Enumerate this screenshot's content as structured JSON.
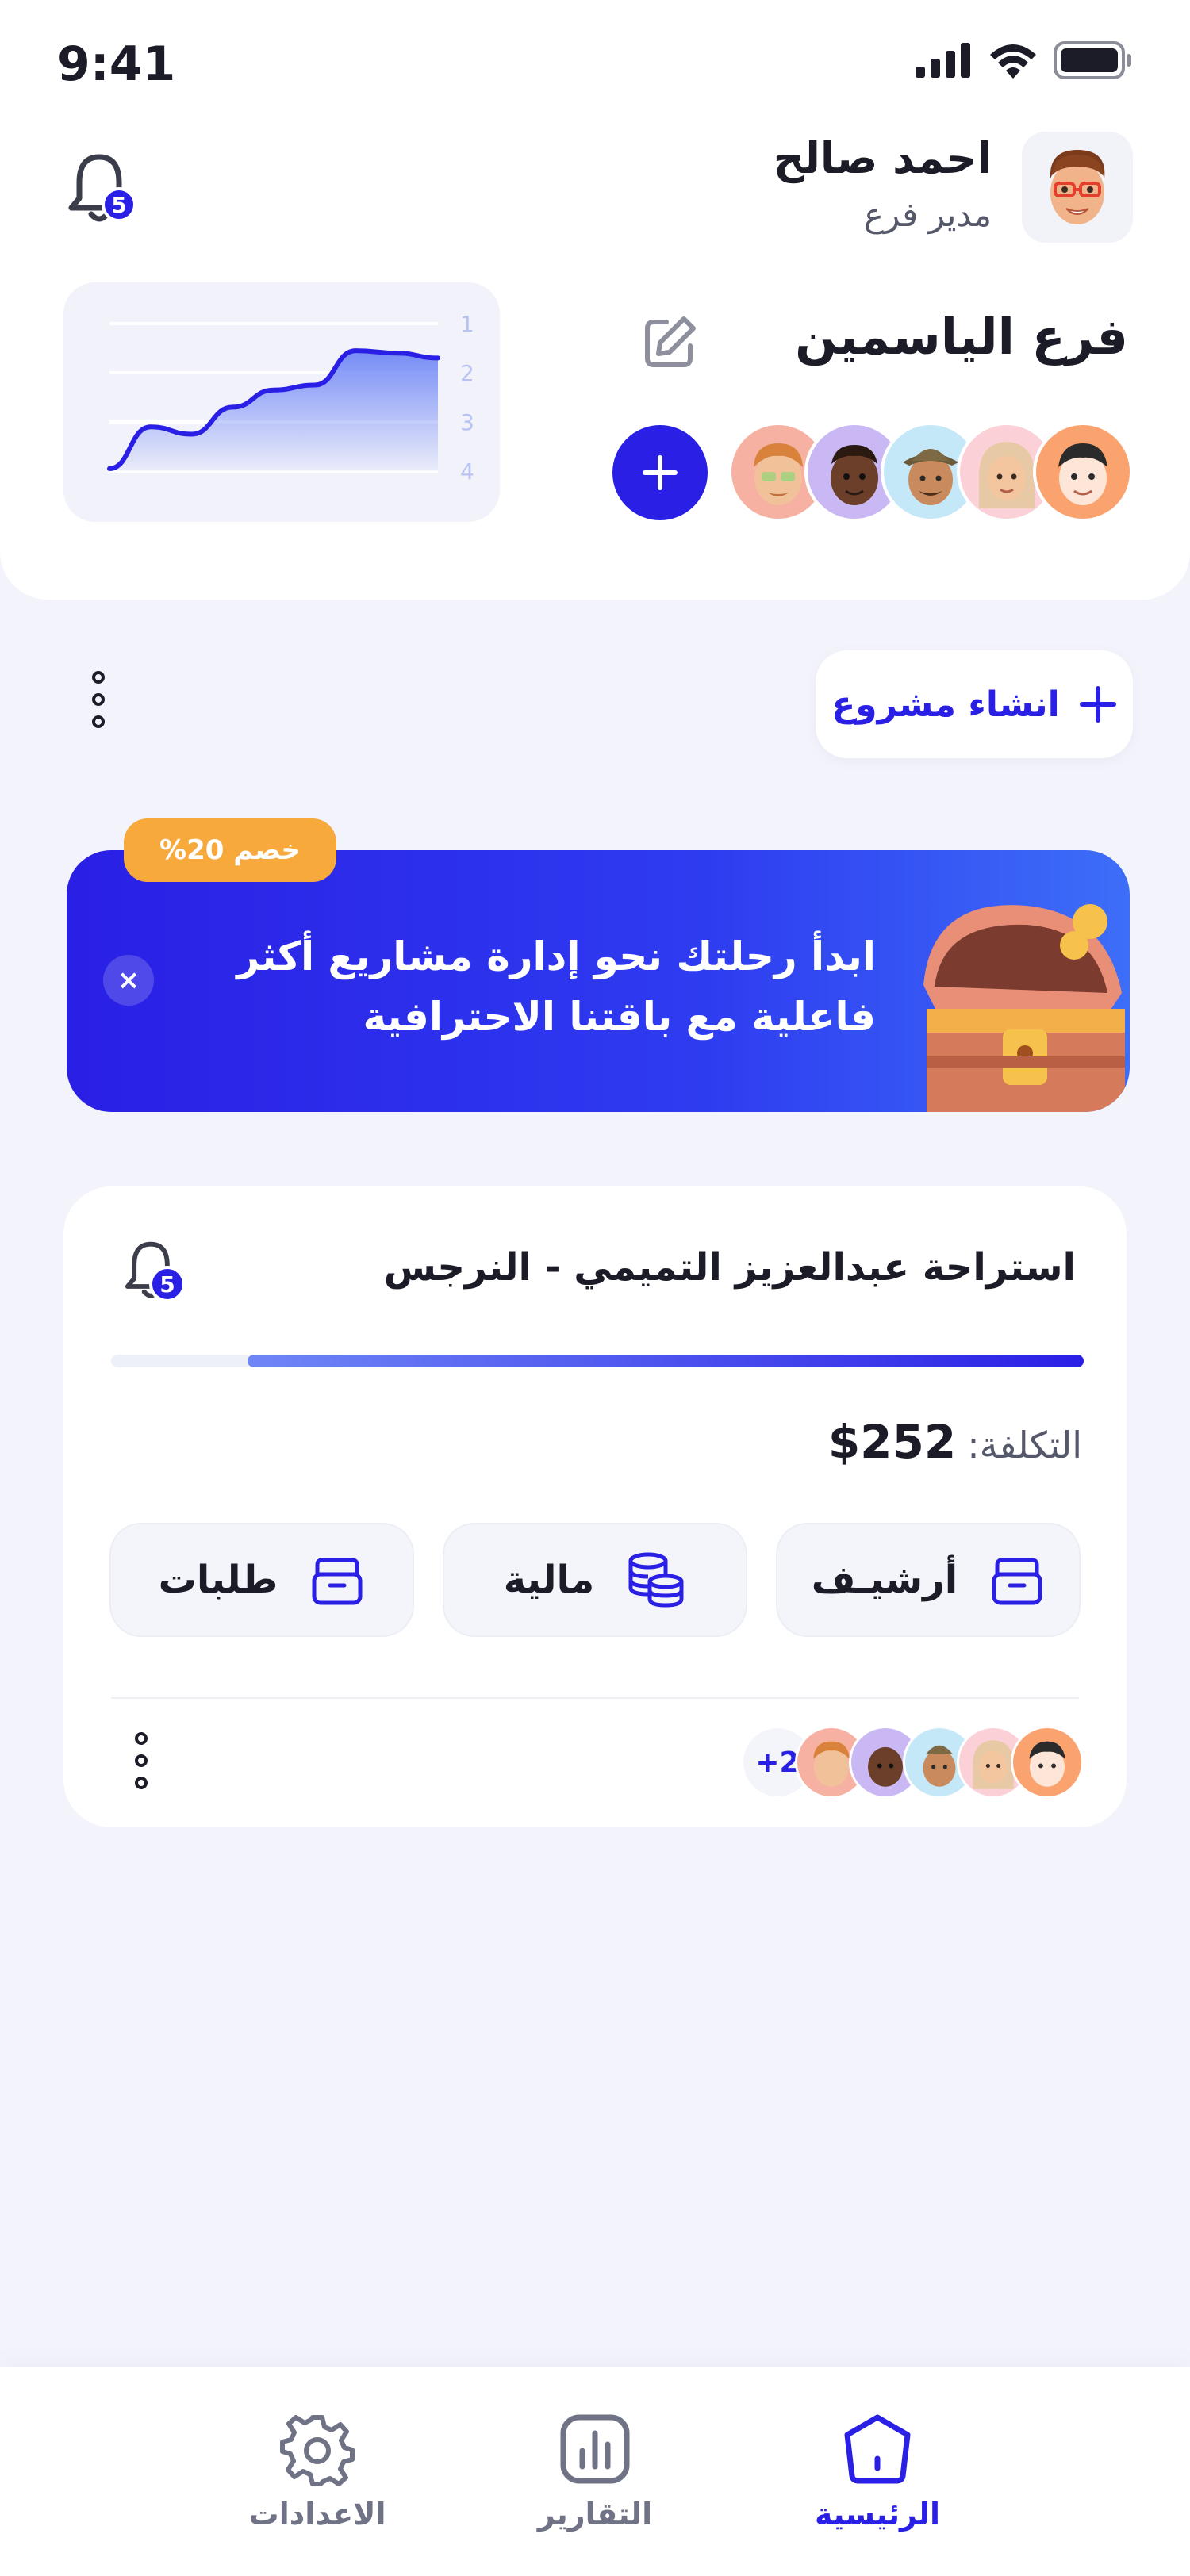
{
  "status_bar": {
    "time": "9:41"
  },
  "header": {
    "user_name": "احمد صالح",
    "user_role": "مدير فرع",
    "notification_count": "5",
    "branch_name": "فرع الياسمين",
    "chart_axis_labels": [
      "1",
      "2",
      "3",
      "4"
    ]
  },
  "chart_data": {
    "type": "area",
    "title": "",
    "xlabel": "",
    "ylabel": "",
    "y_tick_labels": [
      "1",
      "2",
      "3",
      "4"
    ],
    "ylim": [
      1,
      4
    ],
    "y_inverted": true,
    "x": [
      0,
      1,
      2,
      3,
      4,
      5,
      6,
      7,
      8
    ],
    "y": [
      3.95,
      3.1,
      3.25,
      2.7,
      2.35,
      2.25,
      1.55,
      1.6,
      1.7
    ],
    "grid": true,
    "colors": {
      "line": "#2a1fe5",
      "fill": "#6f86f6"
    }
  },
  "toolbar": {
    "create_project_label": "انشاء مشروع"
  },
  "promo": {
    "discount_label": "خصم 20%",
    "text": "ابدأ رحلتك نحو إدارة مشاريع أكثر فاعلية مع باقتنا الاحترافية",
    "close_symbol": "×"
  },
  "project": {
    "title": "استراحة عبدالعزيز التميمي - النرجس",
    "notification_count": "5",
    "progress": 0.86,
    "cost_label": "التكلفة:",
    "cost_value": "$252",
    "actions": [
      {
        "label": "أرشيـف",
        "icon": "archive-box-icon"
      },
      {
        "label": "مالية",
        "icon": "coins-stack-icon"
      },
      {
        "label": "طلبات",
        "icon": "archive-box-icon"
      }
    ],
    "members_extra": "+2"
  },
  "bottom_nav": {
    "items": [
      {
        "label": "الرئيسية",
        "icon": "home-icon",
        "active": true
      },
      {
        "label": "التقارير",
        "icon": "chart-icon",
        "active": false
      },
      {
        "label": "الاعدادات",
        "icon": "gear-icon",
        "active": false
      }
    ]
  },
  "colors": {
    "accent": "#2a1fe5",
    "badge_orange": "#f8a93c",
    "background": "#f3f4fb"
  }
}
